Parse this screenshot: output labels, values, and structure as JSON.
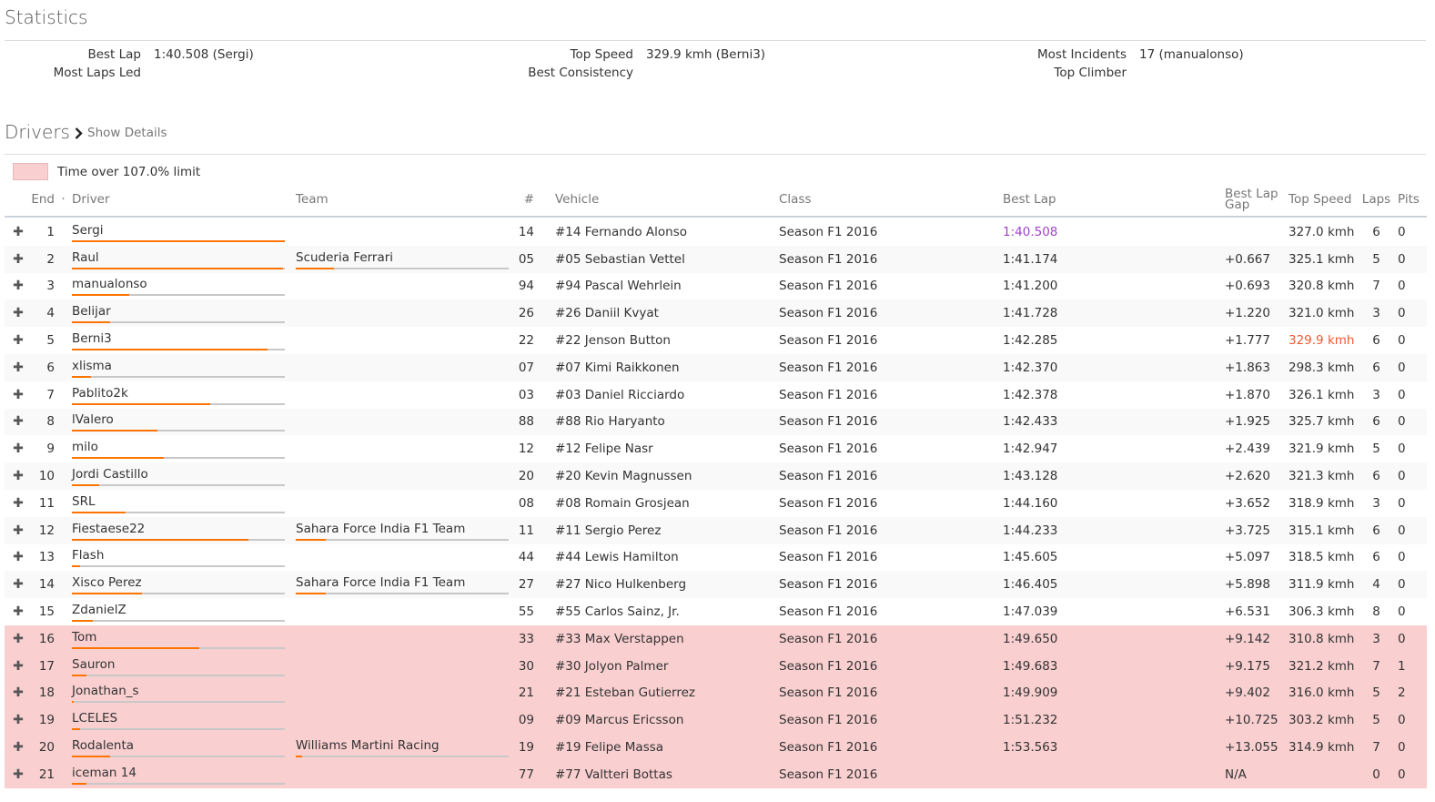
{
  "statistics": {
    "title": "Statistics",
    "best_lap_label": "Best Lap",
    "best_lap_value": "1:40.508 (Sergi)",
    "most_laps_led_label": "Most Laps Led",
    "top_speed_label": "Top Speed",
    "top_speed_value": "329.9 kmh (Berni3)",
    "best_consistency_label": "Best Consistency",
    "most_incidents_label": "Most Incidents",
    "most_incidents_value": "17 (manualonso)",
    "top_climber_label": "Top Climber"
  },
  "drivers": {
    "title": "Drivers",
    "show_details": "Show Details",
    "legend": "Time over 107.0% limit",
    "columns": {
      "end": "End",
      "sort": "·",
      "driver": "Driver",
      "team": "Team",
      "num": "#",
      "vehicle": "Vehicle",
      "class": "Class",
      "best_lap": "Best Lap",
      "gap1": "Best Lap",
      "gap2": "Gap",
      "top_speed": "Top Speed",
      "laps": "Laps",
      "pits": "Pits"
    },
    "colors": {
      "bar": "#ff7400",
      "over_limit": "#f9cfd0",
      "best_lap": "#a043c8",
      "top_speed": "#ef5a32"
    },
    "rows": [
      {
        "end": "1",
        "driver": "Sergi",
        "driver_bar": 1.0,
        "team": "",
        "team_bar": 0,
        "num": "14",
        "vehicle": "#14 Fernando Alonso",
        "class": "Season F1 2016",
        "best_lap": "1:40.508",
        "gap": "",
        "top_speed": "327.0 kmh",
        "laps": "6",
        "pits": "0",
        "over": false,
        "best": true
      },
      {
        "end": "2",
        "driver": "Raul",
        "driver_bar": 0.99,
        "team": "Scuderia Ferrari",
        "team_bar": 0.18,
        "num": "05",
        "vehicle": "#05 Sebastian Vettel",
        "class": "Season F1 2016",
        "best_lap": "1:41.174",
        "gap": "+0.667",
        "top_speed": "325.1 kmh",
        "laps": "5",
        "pits": "0",
        "over": false
      },
      {
        "end": "3",
        "driver": "manualonso",
        "driver_bar": 0.27,
        "team": "",
        "team_bar": 0,
        "num": "94",
        "vehicle": "#94 Pascal Wehrlein",
        "class": "Season F1 2016",
        "best_lap": "1:41.200",
        "gap": "+0.693",
        "top_speed": "320.8 kmh",
        "laps": "7",
        "pits": "0",
        "over": false
      },
      {
        "end": "4",
        "driver": "Belijar",
        "driver_bar": 0.18,
        "team": "",
        "team_bar": 0,
        "num": "26",
        "vehicle": "#26 Daniil Kvyat",
        "class": "Season F1 2016",
        "best_lap": "1:41.728",
        "gap": "+1.220",
        "top_speed": "321.0 kmh",
        "laps": "3",
        "pits": "0",
        "over": false
      },
      {
        "end": "5",
        "driver": "Berni3",
        "driver_bar": 0.92,
        "team": "",
        "team_bar": 0,
        "num": "22",
        "vehicle": "#22 Jenson Button",
        "class": "Season F1 2016",
        "best_lap": "1:42.285",
        "gap": "+1.777",
        "top_speed": "329.9 kmh",
        "laps": "6",
        "pits": "0",
        "over": false,
        "fastest": true
      },
      {
        "end": "6",
        "driver": "xlisma",
        "driver_bar": 0.09,
        "team": "",
        "team_bar": 0,
        "num": "07",
        "vehicle": "#07 Kimi Raikkonen",
        "class": "Season F1 2016",
        "best_lap": "1:42.370",
        "gap": "+1.863",
        "top_speed": "298.3 kmh",
        "laps": "6",
        "pits": "0",
        "over": false
      },
      {
        "end": "7",
        "driver": "Pablito2k",
        "driver_bar": 0.65,
        "team": "",
        "team_bar": 0,
        "num": "03",
        "vehicle": "#03 Daniel Ricciardo",
        "class": "Season F1 2016",
        "best_lap": "1:42.378",
        "gap": "+1.870",
        "top_speed": "326.1 kmh",
        "laps": "3",
        "pits": "0",
        "over": false
      },
      {
        "end": "8",
        "driver": "lValero",
        "driver_bar": 0.4,
        "team": "",
        "team_bar": 0,
        "num": "88",
        "vehicle": "#88 Rio Haryanto",
        "class": "Season F1 2016",
        "best_lap": "1:42.433",
        "gap": "+1.925",
        "top_speed": "325.7 kmh",
        "laps": "6",
        "pits": "0",
        "over": false
      },
      {
        "end": "9",
        "driver": "milo",
        "driver_bar": 0.43,
        "team": "",
        "team_bar": 0,
        "num": "12",
        "vehicle": "#12 Felipe Nasr",
        "class": "Season F1 2016",
        "best_lap": "1:42.947",
        "gap": "+2.439",
        "top_speed": "321.9 kmh",
        "laps": "5",
        "pits": "0",
        "over": false
      },
      {
        "end": "10",
        "driver": "Jordi Castillo",
        "driver_bar": 0.13,
        "team": "",
        "team_bar": 0,
        "num": "20",
        "vehicle": "#20 Kevin Magnussen",
        "class": "Season F1 2016",
        "best_lap": "1:43.128",
        "gap": "+2.620",
        "top_speed": "321.3 kmh",
        "laps": "6",
        "pits": "0",
        "over": false
      },
      {
        "end": "11",
        "driver": "SRL",
        "driver_bar": 0.25,
        "team": "",
        "team_bar": 0,
        "num": "08",
        "vehicle": "#08 Romain Grosjean",
        "class": "Season F1 2016",
        "best_lap": "1:44.160",
        "gap": "+3.652",
        "top_speed": "318.9 kmh",
        "laps": "3",
        "pits": "0",
        "over": false
      },
      {
        "end": "12",
        "driver": "Fiestaese22",
        "driver_bar": 0.83,
        "team": "Sahara Force India F1 Team",
        "team_bar": 0.14,
        "num": "11",
        "vehicle": "#11 Sergio Perez",
        "class": "Season F1 2016",
        "best_lap": "1:44.233",
        "gap": "+3.725",
        "top_speed": "315.1 kmh",
        "laps": "6",
        "pits": "0",
        "over": false
      },
      {
        "end": "13",
        "driver": "Flash",
        "driver_bar": 0.04,
        "team": "",
        "team_bar": 0,
        "num": "44",
        "vehicle": "#44 Lewis Hamilton",
        "class": "Season F1 2016",
        "best_lap": "1:45.605",
        "gap": "+5.097",
        "top_speed": "318.5 kmh",
        "laps": "6",
        "pits": "0",
        "over": false
      },
      {
        "end": "14",
        "driver": "Xisco Perez",
        "driver_bar": 0.33,
        "team": "Sahara Force India F1 Team",
        "team_bar": 0.14,
        "num": "27",
        "vehicle": "#27 Nico Hulkenberg",
        "class": "Season F1 2016",
        "best_lap": "1:46.405",
        "gap": "+5.898",
        "top_speed": "311.9 kmh",
        "laps": "4",
        "pits": "0",
        "over": false
      },
      {
        "end": "15",
        "driver": "ZdanielZ",
        "driver_bar": 0.1,
        "team": "",
        "team_bar": 0,
        "num": "55",
        "vehicle": "#55 Carlos Sainz, Jr.",
        "class": "Season F1 2016",
        "best_lap": "1:47.039",
        "gap": "+6.531",
        "top_speed": "306.3 kmh",
        "laps": "8",
        "pits": "0",
        "over": false
      },
      {
        "end": "16",
        "driver": "Tom",
        "driver_bar": 0.6,
        "team": "",
        "team_bar": 0,
        "num": "33",
        "vehicle": "#33 Max Verstappen",
        "class": "Season F1 2016",
        "best_lap": "1:49.650",
        "gap": "+9.142",
        "top_speed": "310.8 kmh",
        "laps": "3",
        "pits": "0",
        "over": true
      },
      {
        "end": "17",
        "driver": "Sauron",
        "driver_bar": 0.07,
        "team": "",
        "team_bar": 0,
        "num": "30",
        "vehicle": "#30 Jolyon Palmer",
        "class": "Season F1 2016",
        "best_lap": "1:49.683",
        "gap": "+9.175",
        "top_speed": "321.2 kmh",
        "laps": "7",
        "pits": "1",
        "over": true
      },
      {
        "end": "18",
        "driver": "Jonathan_s",
        "driver_bar": 0.01,
        "team": "",
        "team_bar": 0,
        "num": "21",
        "vehicle": "#21 Esteban Gutierrez",
        "class": "Season F1 2016",
        "best_lap": "1:49.909",
        "gap": "+9.402",
        "top_speed": "316.0 kmh",
        "laps": "5",
        "pits": "2",
        "over": true
      },
      {
        "end": "19",
        "driver": "LCELES",
        "driver_bar": 0.04,
        "team": "",
        "team_bar": 0,
        "num": "09",
        "vehicle": "#09 Marcus Ericsson",
        "class": "Season F1 2016",
        "best_lap": "1:51.232",
        "gap": "+10.725",
        "top_speed": "303.2 kmh",
        "laps": "5",
        "pits": "0",
        "over": true
      },
      {
        "end": "20",
        "driver": "Rodalenta",
        "driver_bar": 0.18,
        "team": "Williams Martini Racing",
        "team_bar": 0.03,
        "num": "19",
        "vehicle": "#19 Felipe Massa",
        "class": "Season F1 2016",
        "best_lap": "1:53.563",
        "gap": "+13.055",
        "top_speed": "314.9 kmh",
        "laps": "7",
        "pits": "0",
        "over": true
      },
      {
        "end": "21",
        "driver": "iceman 14",
        "driver_bar": 0.07,
        "team": "",
        "team_bar": 0,
        "num": "77",
        "vehicle": "#77 Valtteri Bottas",
        "class": "Season F1 2016",
        "best_lap": "",
        "gap": "N/A",
        "top_speed": "",
        "laps": "0",
        "pits": "0",
        "over": true
      }
    ]
  }
}
